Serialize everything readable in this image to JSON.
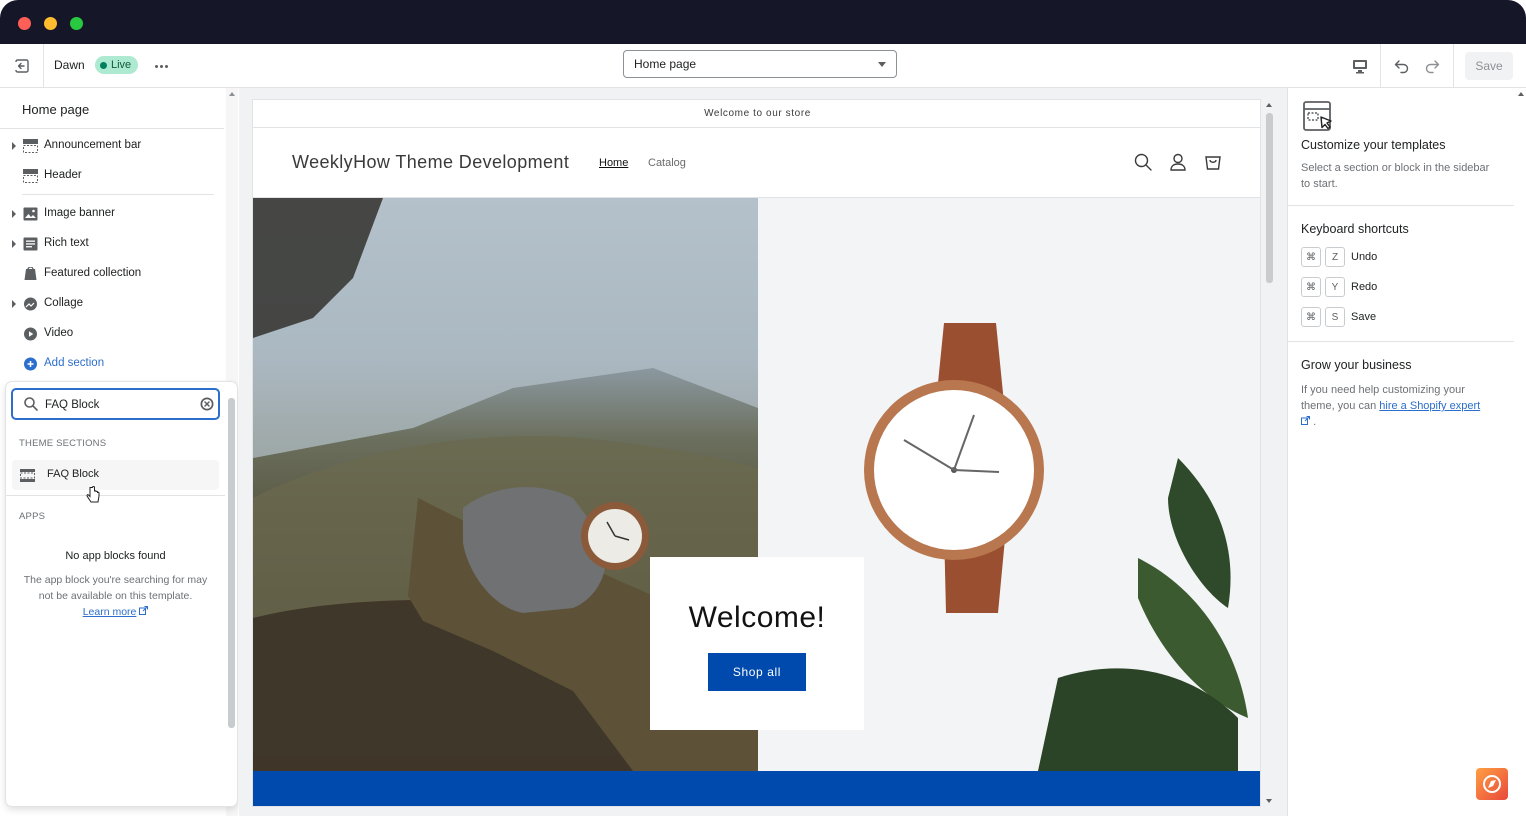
{
  "toolbar": {
    "theme_name": "Dawn",
    "status_badge": "Live",
    "page_select": "Home page",
    "save_label": "Save"
  },
  "sidebar": {
    "title": "Home page",
    "items": [
      {
        "label": "Announcement bar",
        "icon": "layout-bar-icon"
      },
      {
        "label": "Header",
        "icon": "layout-header-icon"
      },
      {
        "label": "Image banner",
        "icon": "image-icon"
      },
      {
        "label": "Rich text",
        "icon": "text-block-icon"
      },
      {
        "label": "Featured collection",
        "icon": "tag-icon"
      },
      {
        "label": "Collage",
        "icon": "collage-icon"
      },
      {
        "label": "Video",
        "icon": "play-icon"
      }
    ],
    "add_section": "Add section"
  },
  "popover": {
    "search_value": "FAQ Block",
    "theme_sections_heading": "THEME SECTIONS",
    "result_label": "FAQ Block",
    "apps_heading": "APPS",
    "no_apps_title": "No app blocks found",
    "no_apps_desc": "The app block you're searching for may not be available on this template.",
    "learn_more": "Learn more"
  },
  "preview": {
    "announcement": "Welcome to our store",
    "store_name": "WeeklyHow Theme Development",
    "nav": {
      "home": "Home",
      "catalog": "Catalog"
    },
    "welcome_title": "Welcome!",
    "shop_button": "Shop all",
    "accent_color": "#004aad"
  },
  "right_sidebar": {
    "customize_title": "Customize your templates",
    "customize_text": "Select a section or block in the sidebar to start.",
    "shortcuts_title": "Keyboard shortcuts",
    "shortcuts": [
      {
        "key": "Z",
        "label": "Undo"
      },
      {
        "key": "Y",
        "label": "Redo"
      },
      {
        "key": "S",
        "label": "Save"
      }
    ],
    "grow_title": "Grow your business",
    "grow_text_pre": "If you need help customizing your theme, you can",
    "grow_link": "hire a Shopify expert",
    "grow_text_post": "."
  }
}
